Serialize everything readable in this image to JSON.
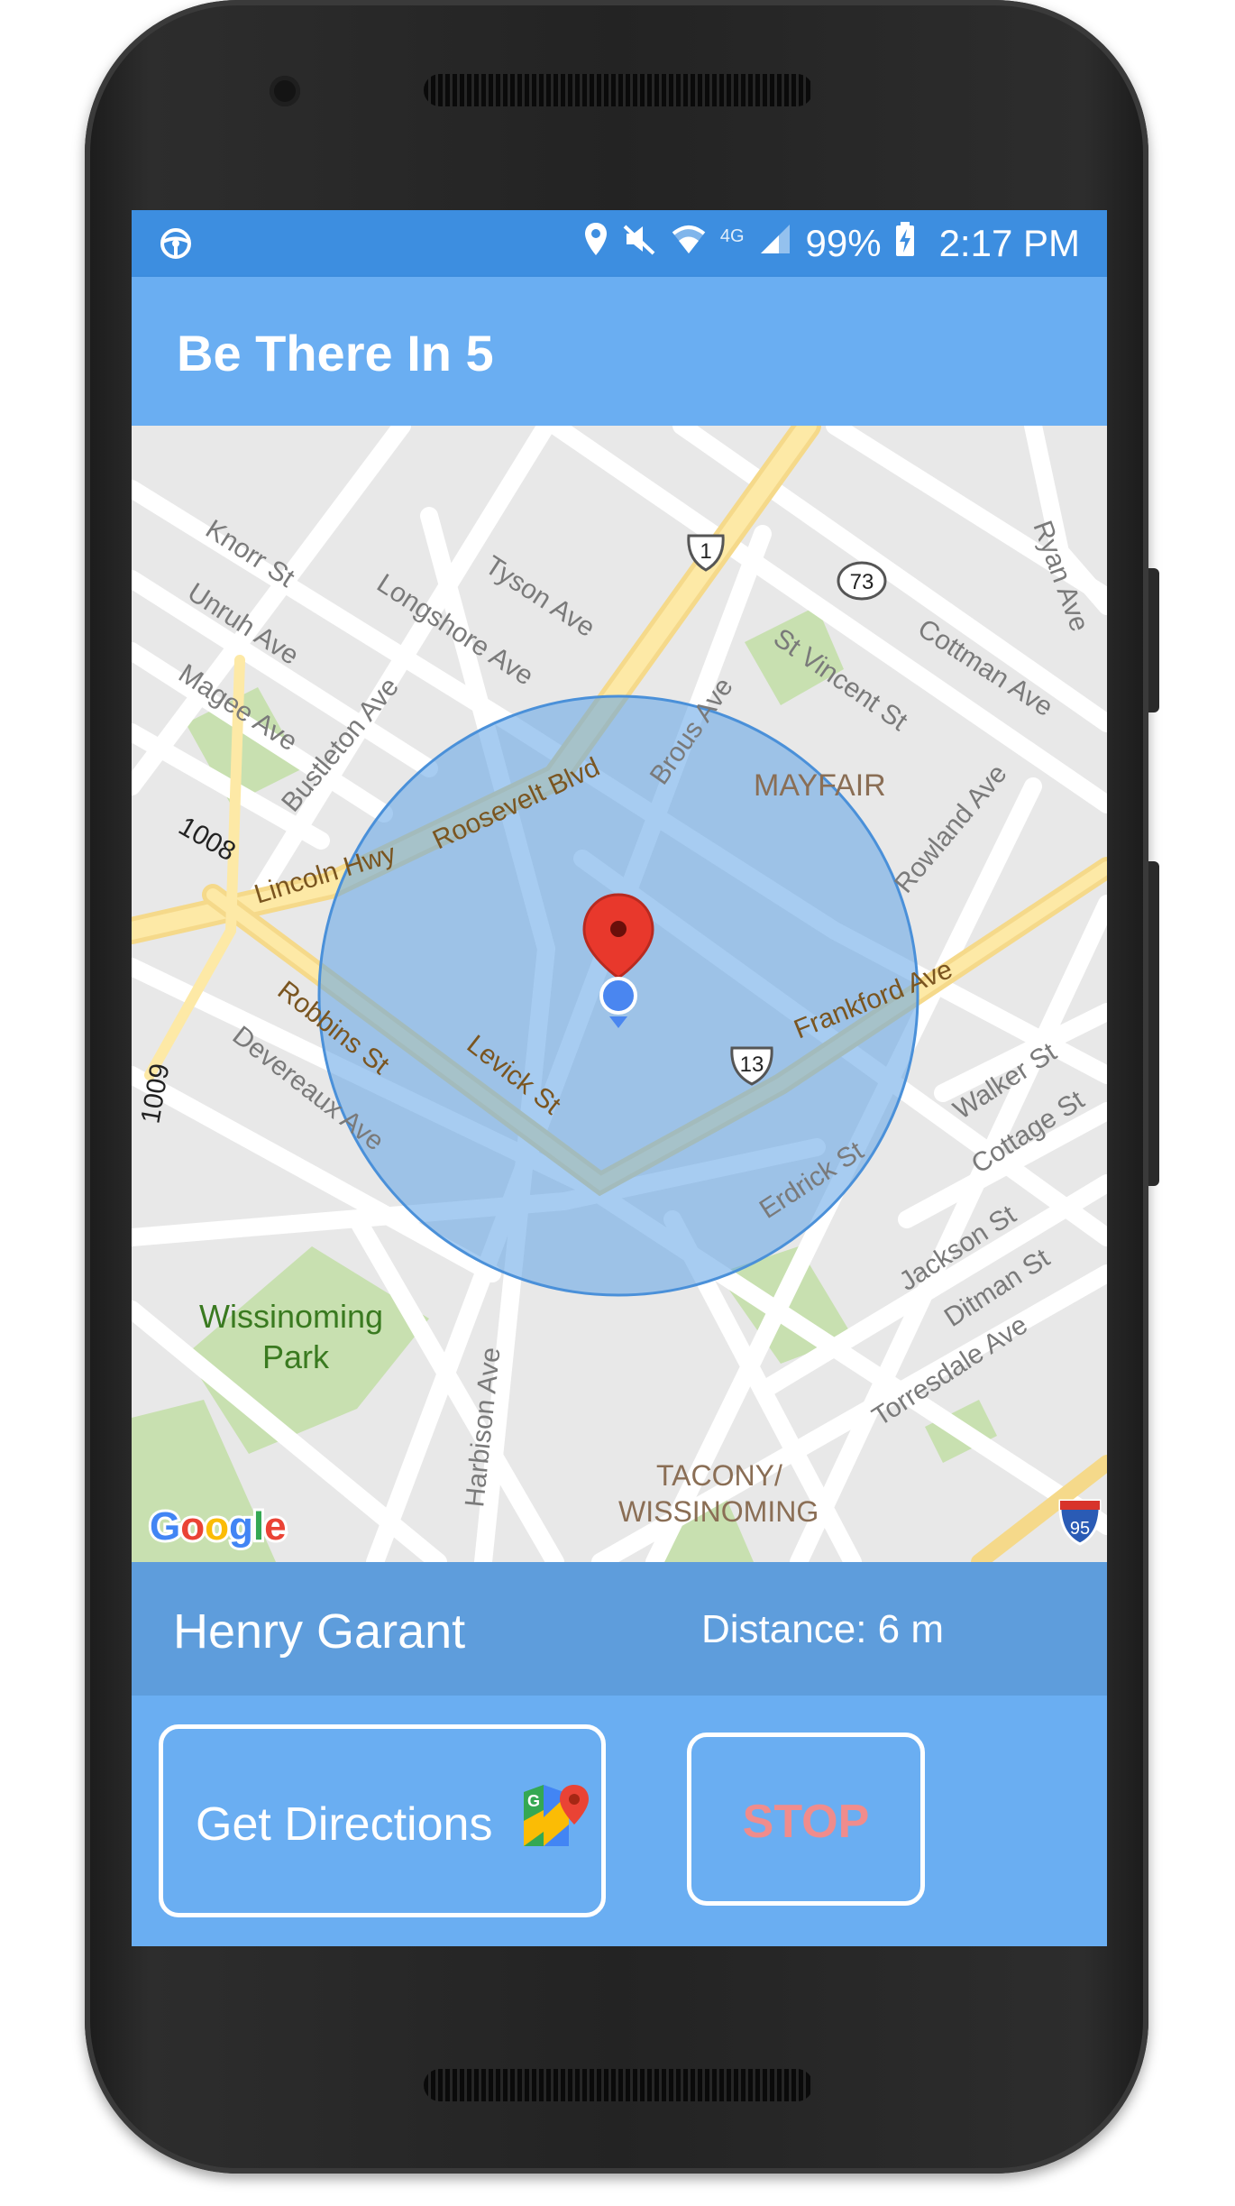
{
  "status_bar": {
    "left_icon": "steering-wheel-icon",
    "network_type": "4G",
    "battery": "99%",
    "time": "2:17 PM",
    "icons": [
      "location-pin-icon",
      "mute-icon",
      "wifi-icon",
      "signal-icon",
      "battery-charging-icon"
    ]
  },
  "app_bar": {
    "title": "Be There In 5"
  },
  "map": {
    "labels": {
      "knorr": "Knorr St",
      "unruh": "Unruh Ave",
      "magee": "Magee Ave",
      "longshore": "Longshore Ave",
      "tyson": "Tyson Ave",
      "bustleton": "Bustleton Ave",
      "r1008": "1008",
      "lincoln": "Lincoln Hwy",
      "roosevelt": "Roosevelt Blvd",
      "brous": "Brous Ave",
      "stvincent": "St Vincent St",
      "cottman": "Cottman Ave",
      "ryan": "Ryan Ave",
      "mayfair": "MAYFAIR",
      "rowland": "Rowland Ave",
      "frankford": "Frankford Ave",
      "robbins": "Robbins St",
      "devereaux": "Devereaux Ave",
      "levick": "Levick St",
      "r1009": "1009",
      "erdrick": "Erdrick St",
      "walker": "Walker St",
      "cottage": "Cottage St",
      "jackson": "Jackson St",
      "ditman": "Ditman St",
      "torresdale": "Torresdale Ave",
      "wiss_park_1": "Wissinoming",
      "wiss_park_2": "Park",
      "harbison": "Harbison Ave",
      "tacony_1": "TACONY/",
      "tacony_2": "WISSINOMING"
    },
    "shields": {
      "us1": "1",
      "pa73": "73",
      "us13": "13",
      "i95": "95"
    },
    "attribution": "Google"
  },
  "info": {
    "contact_name": "Henry Garant",
    "distance": "Distance: 6 m"
  },
  "actions": {
    "directions_label": "Get Directions",
    "directions_icon": "google-maps-icon",
    "stop_label": "STOP"
  },
  "colors": {
    "status_bar": "#3d8ee0",
    "app_bar": "#6aaef2",
    "info_bar": "#5e9ddc",
    "radius_fill": "#5ea3e6",
    "stop_text": "#f08c8c"
  }
}
